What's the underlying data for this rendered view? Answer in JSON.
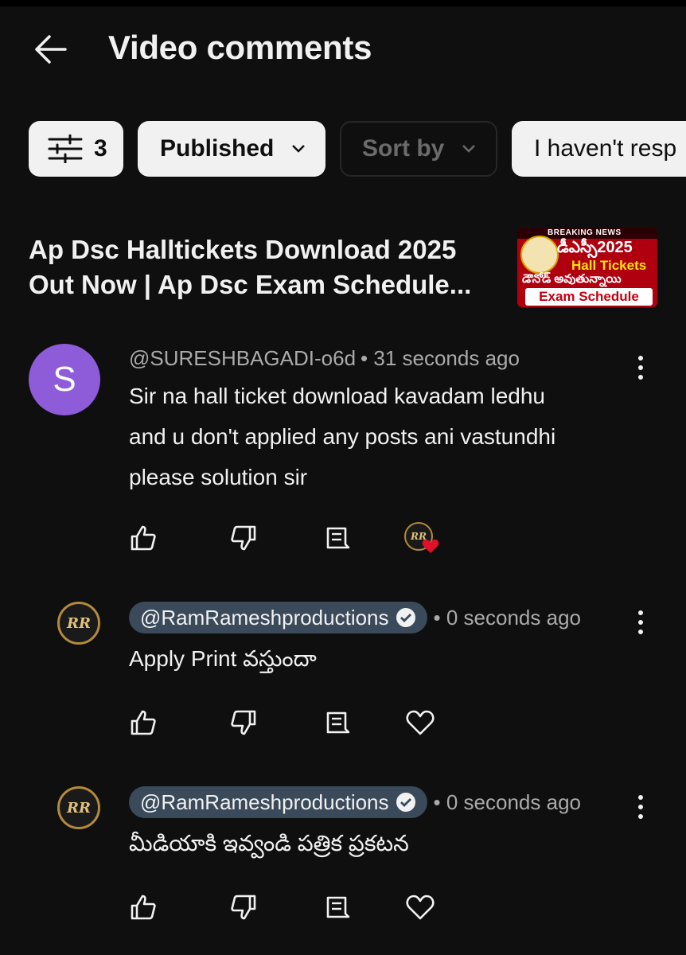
{
  "header": {
    "title": "Video comments"
  },
  "filters": {
    "filter_count": "3",
    "published_label": "Published",
    "sort_label": "Sort by",
    "responded_label": "I haven't resp"
  },
  "video": {
    "title_line1": "Ap Dsc Halltickets Download 2025",
    "title_line2": "Out Now | Ap Dsc Exam Schedule...",
    "thumbnail": {
      "breaking": "BREAKING NEWS",
      "line1": "డీఎస్సీ2025",
      "line2": "Hall Tickets",
      "line3": "డౌనోడ్ అవుతున్నాయి",
      "line4": "Exam Schedule"
    }
  },
  "comments": [
    {
      "avatar_letter": "S",
      "avatar_color": "#8e5bd9",
      "author": "@SURESHBAGADI-o6d",
      "time": "• 31 seconds ago",
      "text_line1": "Sir na hall ticket download kavadam ledhu",
      "text_line2": "and u don't applied any posts ani vastundhi",
      "text_line3": "please solution sir"
    },
    {
      "avatar_label": "RR",
      "author": "@RamRameshproductions",
      "time": "• 0 seconds ago",
      "text_line1": "Apply Print వస్తుందా"
    },
    {
      "avatar_label": "RR",
      "author": "@RamRameshproductions",
      "time": "• 0 seconds ago",
      "text_line1": "మీడియాకి ఇవ్వండి పత్రిక ప్రకటన"
    }
  ],
  "colors": {
    "background": "#0f0f0f",
    "chip_light": "#f1f1f1",
    "handle_pill": "#3a4a5a",
    "heart": "#e0102a"
  },
  "icons": [
    "back-arrow-icon",
    "filter-sliders-icon",
    "chevron-down-icon",
    "thumbs-up-icon",
    "thumbs-down-icon",
    "reply-icon",
    "heart-icon",
    "more-vert-icon",
    "verified-check-icon"
  ]
}
